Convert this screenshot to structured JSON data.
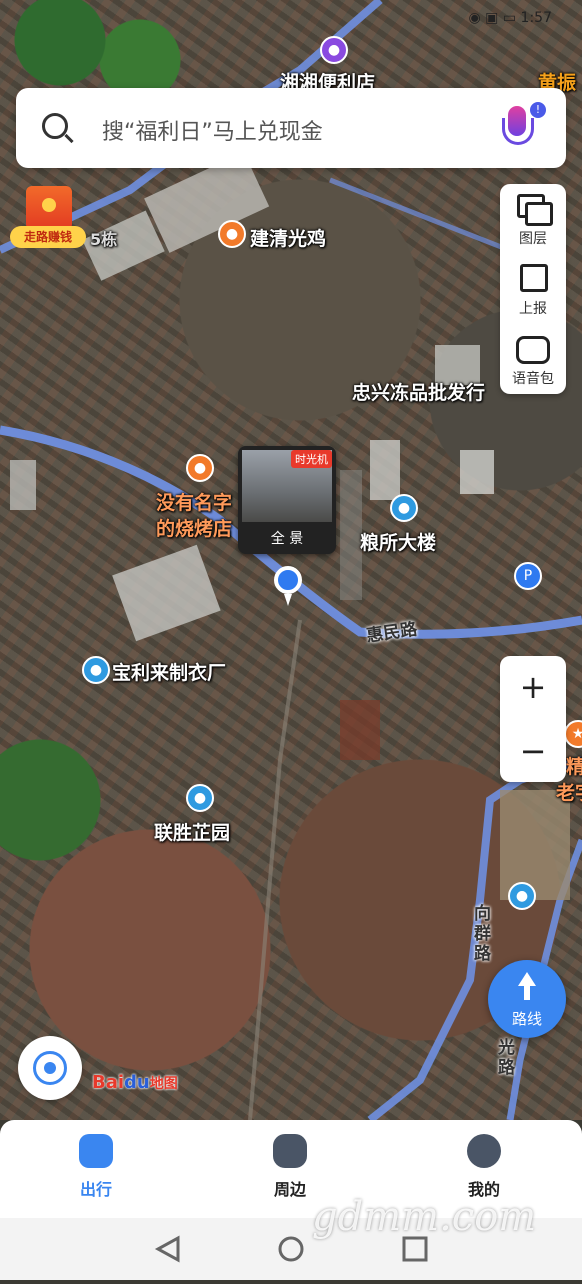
{
  "status_bar": {
    "time": "1:57"
  },
  "search": {
    "placeholder": "搜“福利日”马上兑现金"
  },
  "promo": {
    "label": "走路赚钱"
  },
  "side_tools": [
    {
      "label": "图层",
      "icon": "layers-icon"
    },
    {
      "label": "上报",
      "icon": "report-edit-icon"
    },
    {
      "label": "语音包",
      "icon": "voice-pack-icon"
    }
  ],
  "zoom": {
    "in_label": "+",
    "out_label": "−"
  },
  "pano": {
    "tag": "时光机",
    "label": "全 景"
  },
  "map_labels": {
    "shop_top": "湘湘便利店",
    "top_right": "黄振",
    "bldg_5": "5栋",
    "chicken": "建清光鸡",
    "frozen": "忠兴冻品批发行",
    "bbq_line1": "没有名字",
    "bbq_line2": "的烧烤店",
    "grain": "粮所大楼",
    "road_huimin": "惠民路",
    "garment": "宝利来制衣厂",
    "garden": "联胜芷园",
    "road_xiangqun": "向群路",
    "road_guang": "光路",
    "right_edge1": "精",
    "right_edge2": "老字"
  },
  "route_button": {
    "label": "路线"
  },
  "logo": {
    "text": "Bai",
    "paw": "du",
    "sub": "地图"
  },
  "bottom_nav": [
    {
      "label": "出行",
      "active": true
    },
    {
      "label": "周边",
      "active": false
    },
    {
      "label": "我的",
      "active": false
    }
  ],
  "watermark": "gdmm.com",
  "colors": {
    "accent": "#3a86f0",
    "road": "#6f8fe0",
    "promo_red": "#e23a22"
  }
}
